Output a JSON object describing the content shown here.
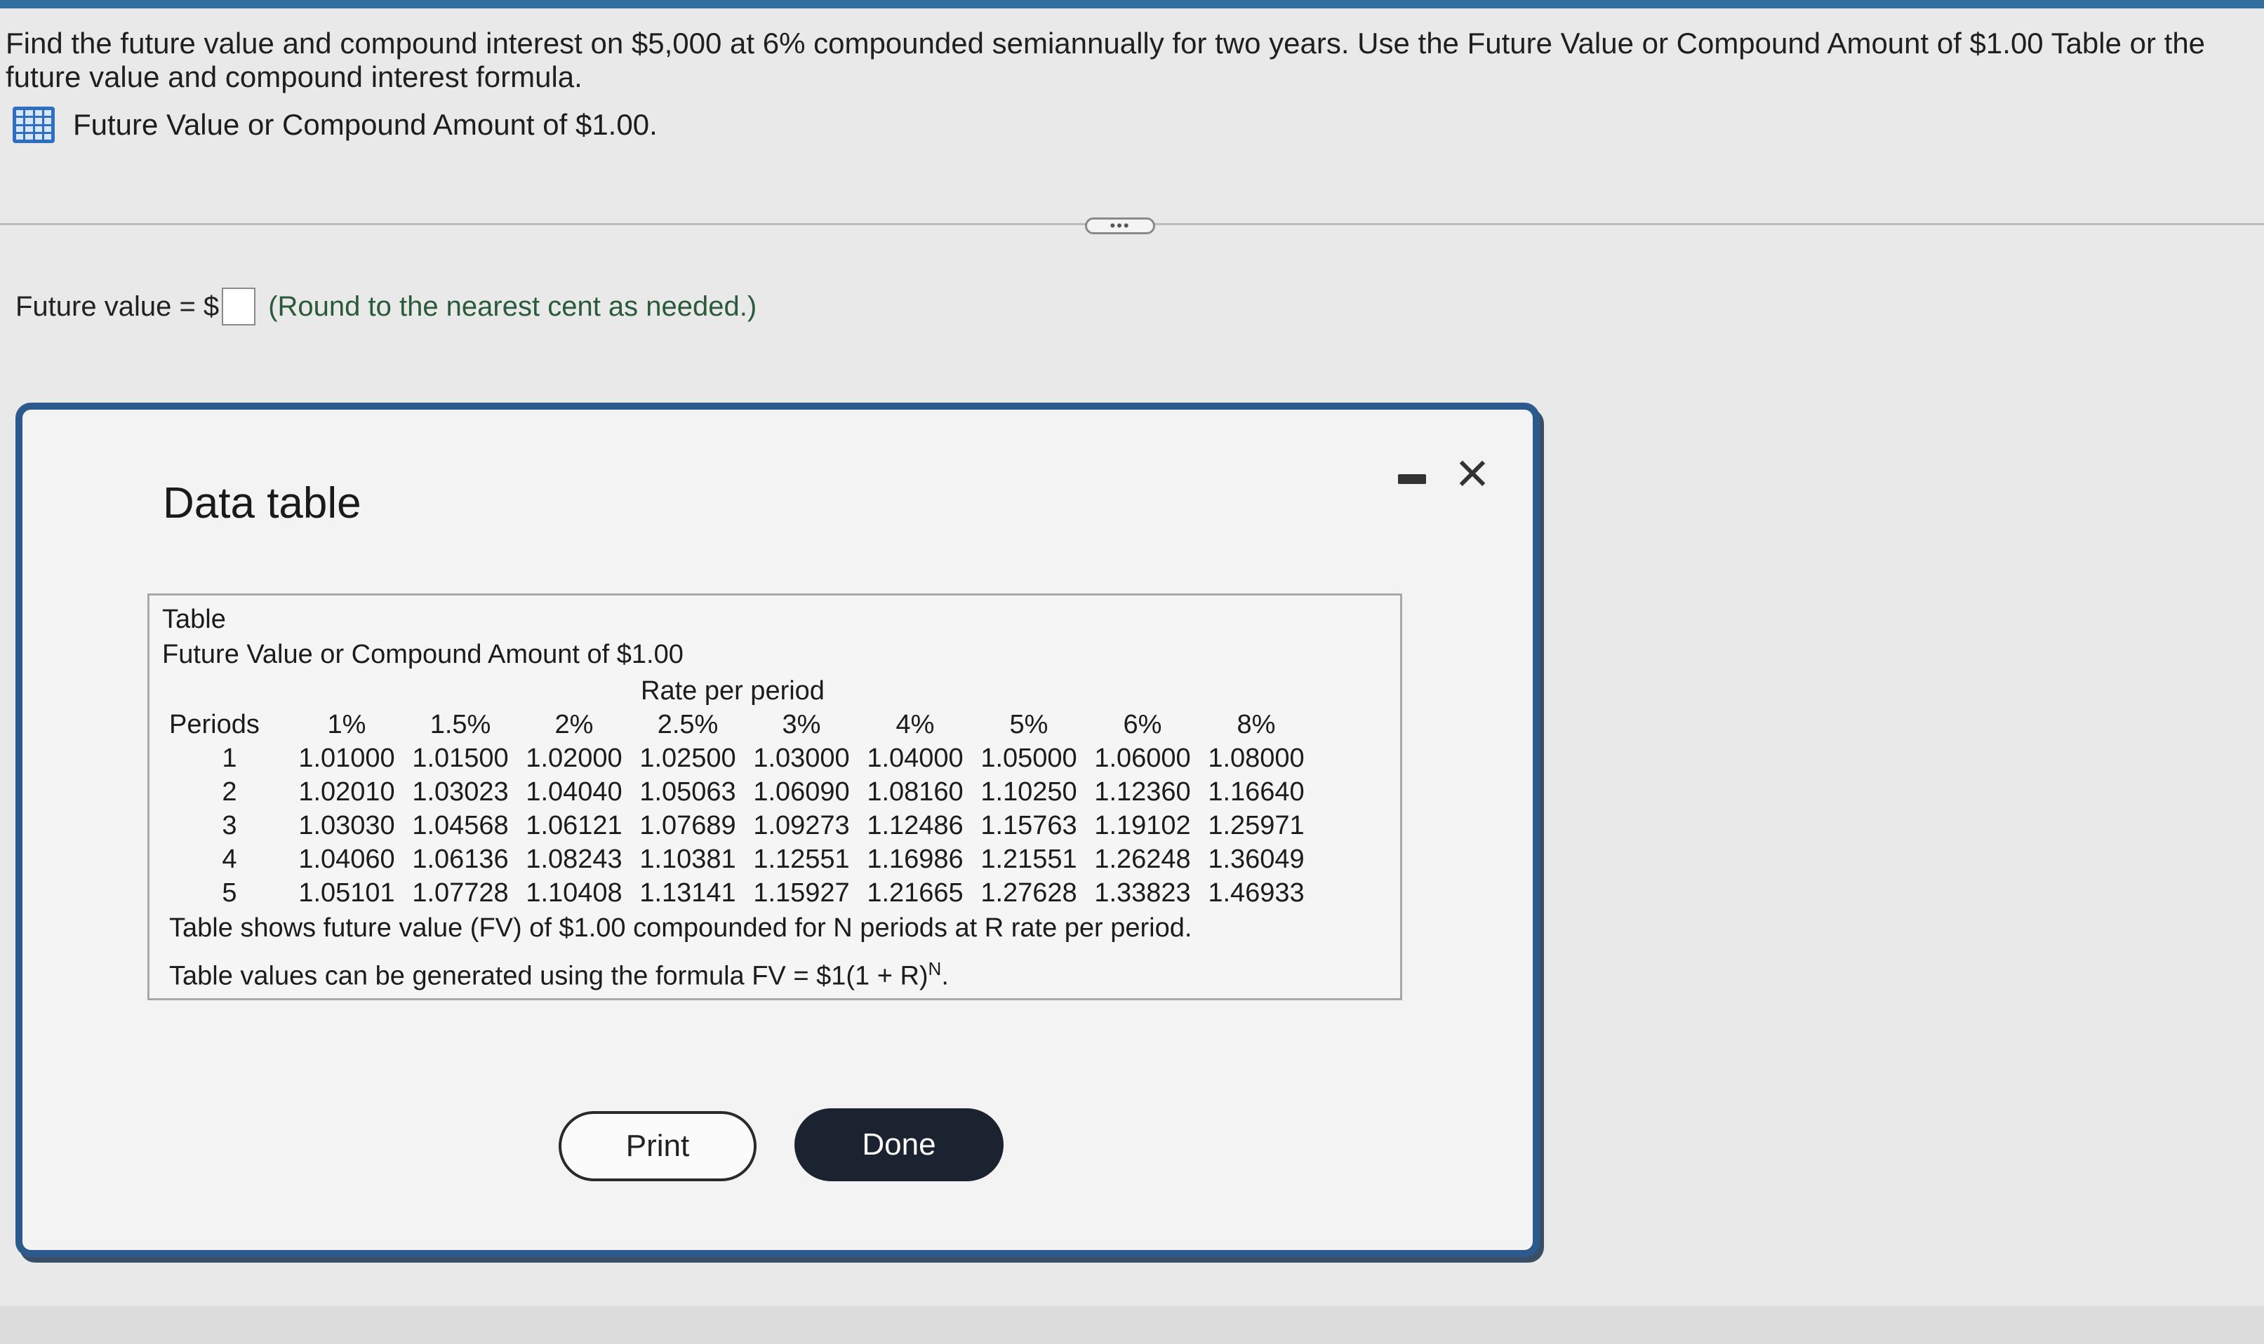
{
  "question": {
    "text": "Find the future value and compound interest on $5,000 at 6% compounded semiannually for two years. Use the Future Value or Compound Amount of $1.00 Table or the future value and compound interest formula.",
    "reference_link": "Future Value or Compound Amount of $1.00."
  },
  "answer": {
    "label": "Future value = $",
    "value": "",
    "hint": "(Round to the nearest cent as needed.)"
  },
  "dialog": {
    "title": "Data table",
    "table": {
      "label": "Table",
      "caption": "Future Value or Compound Amount of $1.00",
      "rate_header": "Rate per period",
      "columns": [
        "Periods",
        "1%",
        "1.5%",
        "2%",
        "2.5%",
        "3%",
        "4%",
        "5%",
        "6%",
        "8%"
      ],
      "rows": [
        [
          "1",
          "1.01000",
          "1.01500",
          "1.02000",
          "1.02500",
          "1.03000",
          "1.04000",
          "1.05000",
          "1.06000",
          "1.08000"
        ],
        [
          "2",
          "1.02010",
          "1.03023",
          "1.04040",
          "1.05063",
          "1.06090",
          "1.08160",
          "1.10250",
          "1.12360",
          "1.16640"
        ],
        [
          "3",
          "1.03030",
          "1.04568",
          "1.06121",
          "1.07689",
          "1.09273",
          "1.12486",
          "1.15763",
          "1.19102",
          "1.25971"
        ],
        [
          "4",
          "1.04060",
          "1.06136",
          "1.08243",
          "1.10381",
          "1.12551",
          "1.16986",
          "1.21551",
          "1.26248",
          "1.36049"
        ],
        [
          "5",
          "1.05101",
          "1.07728",
          "1.10408",
          "1.13141",
          "1.15927",
          "1.21665",
          "1.27628",
          "1.33823",
          "1.46933"
        ]
      ],
      "note_1": "Table shows future value (FV) of $1.00 compounded for N periods at R rate per period.",
      "note_2": "Table values can be generated using the formula FV = $1(1 + R)",
      "note_2_exponent": "N",
      "note_2_end": "."
    },
    "print_label": "Print",
    "done_label": "Done",
    "close_label": "×"
  },
  "more_indicator": "•••"
}
